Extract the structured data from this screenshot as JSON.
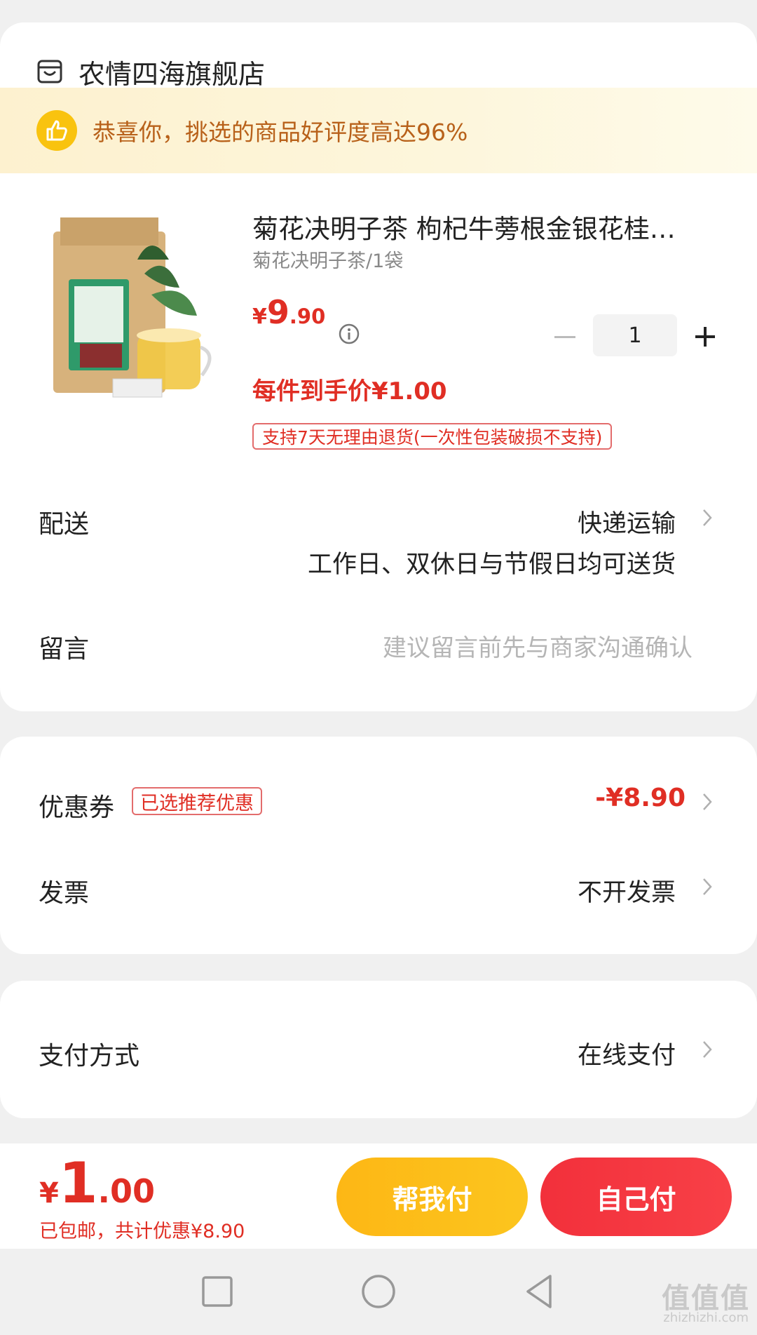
{
  "store": {
    "name": "农情四海旗舰店"
  },
  "banner": {
    "text": "恭喜你，挑选的商品好评度高达96%"
  },
  "product": {
    "title": "菊花决明子茶 枸杞牛蒡根金银花桂…",
    "spec": "菊花决明子茶/1袋",
    "price_currency": "¥",
    "price_integer": "9",
    "price_decimal": ".90",
    "quantity": "1",
    "unit_price": "每件到手价¥1.00",
    "return_policy": "支持7天无理由退货(一次性包装破损不支持)"
  },
  "delivery": {
    "label": "配送",
    "method": "快递运输",
    "note": "工作日、双休日与节假日均可送货"
  },
  "message": {
    "label": "留言",
    "placeholder": "建议留言前先与商家沟通确认"
  },
  "coupon": {
    "label": "优惠券",
    "badge": "已选推荐优惠",
    "value": "-¥8.90"
  },
  "invoice": {
    "label": "发票",
    "value": "不开发票"
  },
  "payment": {
    "label": "支付方式",
    "value": "在线支付"
  },
  "footer": {
    "total_currency": "¥",
    "total_integer": "1",
    "total_decimal": ".00",
    "note": "已包邮，共计优惠¥8.90",
    "help_pay": "帮我付",
    "self_pay": "自己付"
  },
  "watermark": {
    "text": "值值值",
    "sub": "zhizhizhi.com"
  },
  "colors": {
    "accent_red": "#e02e24",
    "banner_text": "#b8611a",
    "help_btn": "#fdb715",
    "self_btn": "#f2303b"
  }
}
